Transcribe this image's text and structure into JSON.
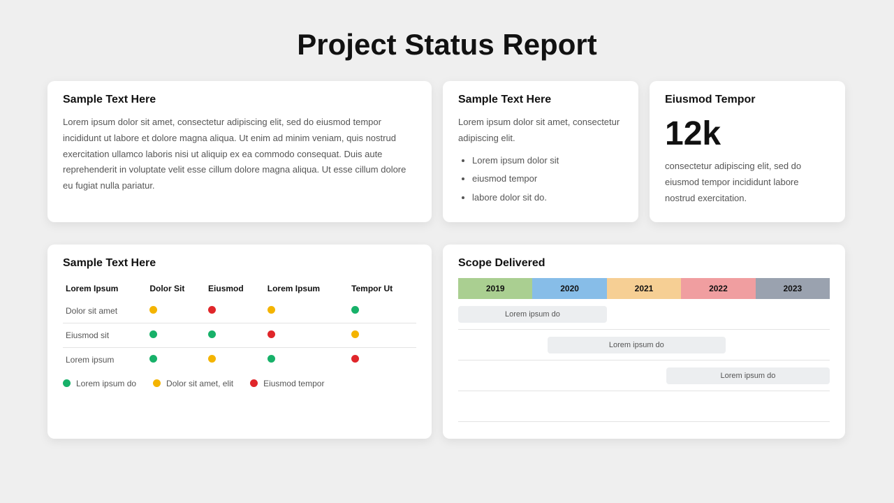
{
  "title": "Project Status Report",
  "card1": {
    "title": "Sample Text Here",
    "body": "Lorem ipsum dolor sit amet, consectetur adipiscing elit, sed do eiusmod tempor incididunt ut labore et dolore magna aliqua. Ut enim ad minim veniam, quis nostrud exercitation ullamco laboris nisi ut aliquip ex ea commodo consequat. Duis aute reprehenderit in voluptate velit esse cillum dolore magna aliqua. Ut esse cillum dolore eu fugiat nulla pariatur."
  },
  "card2": {
    "title": "Sample Text Here",
    "lead": "Lorem ipsum dolor sit amet, consectetur adipiscing elit.",
    "bullets": [
      "Lorem ipsum dolor sit",
      "eiusmod tempor",
      "labore dolor sit do."
    ]
  },
  "card3": {
    "title": "Eiusmod  Tempor",
    "metric": "12k",
    "body": "consectetur adipiscing elit, sed do eiusmod tempor incididunt labore nostrud exercitation."
  },
  "status": {
    "title": "Sample Text Here",
    "columns": [
      "Lorem Ipsum",
      "Dolor Sit",
      "Eiusmod",
      "Lorem Ipsum",
      "Tempor Ut"
    ],
    "rows": [
      {
        "label": "Dolor sit amet",
        "cells": [
          "y",
          "r",
          "y",
          "g"
        ]
      },
      {
        "label": "Eiusmod sit",
        "cells": [
          "g",
          "g",
          "r",
          "y"
        ]
      },
      {
        "label": "Lorem ipsum",
        "cells": [
          "g",
          "y",
          "g",
          "r"
        ]
      }
    ],
    "legend": [
      {
        "color": "g",
        "label": "Lorem ipsum do"
      },
      {
        "color": "y",
        "label": "Dolor sit amet, elit"
      },
      {
        "color": "r",
        "label": "Eiusmod tempor"
      }
    ]
  },
  "scope": {
    "title": "Scope Delivered",
    "years": [
      "2019",
      "2020",
      "2021",
      "2022",
      "2023"
    ],
    "bars": [
      "Lorem ipsum do",
      "Lorem ipsum do",
      "Lorem ipsum do"
    ]
  },
  "chart_data": {
    "type": "table",
    "title": "Scope Delivered",
    "categories": [
      "2019",
      "2020",
      "2021",
      "2022",
      "2023"
    ],
    "series": [
      {
        "name": "Lorem ipsum do",
        "start": "2019",
        "end": "2020"
      },
      {
        "name": "Lorem ipsum do",
        "start": "2020",
        "end": "2022"
      },
      {
        "name": "Lorem ipsum do",
        "start": "2022",
        "end": "2023"
      }
    ]
  }
}
